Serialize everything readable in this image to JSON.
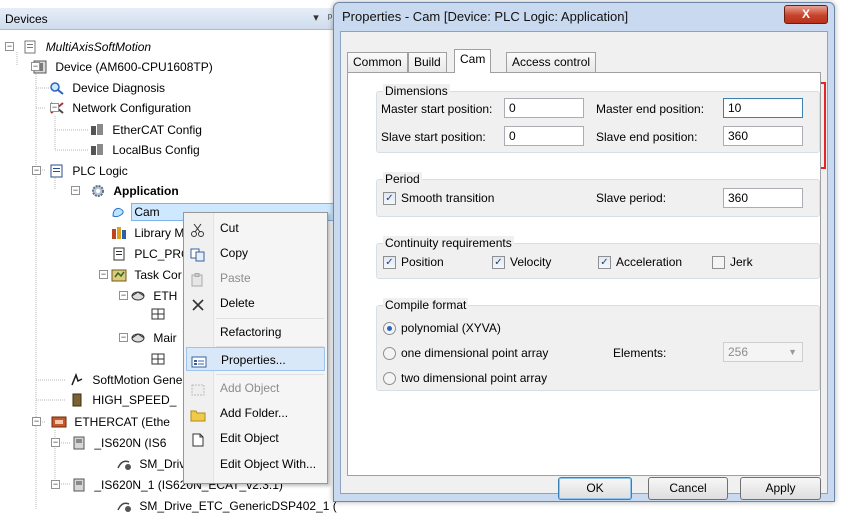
{
  "devices_panel": {
    "title": "Devices",
    "pin_glyph": "▾",
    "dock_glyph": "ᵖ"
  },
  "tree": {
    "project": "MultiAxisSoftMotion",
    "device": "Device (AM600-CPU1608TP)",
    "device_diagnosis": "Device Diagnosis",
    "network_configuration": "Network Configuration",
    "ethercat_config": "EtherCAT Config",
    "localbus_config": "LocalBus Config",
    "plc_logic": "PLC Logic",
    "application": "Application",
    "cam": "Cam",
    "library_manager": "Library M",
    "plc_prg": "PLC_PRC",
    "task_configuration": "Task Cor",
    "ethercat_task": "ETH",
    "main_task": "Mair",
    "softmotion_general": "SoftMotion Gene",
    "high_speed": "HIGH_SPEED_",
    "ethercat_master": "ETHERCAT (Ethe",
    "is620n": "_IS620N (IS6",
    "sm_drive_short": "SM_Driv",
    "is620n_1": "_IS620N_1 (IS620N_ECAT_v2.3.1)",
    "sm_drive_1": "SM_Drive_ETC_GenericDSP402_1 ("
  },
  "context_menu": {
    "items": [
      {
        "label": "Cut",
        "icon": "scissors-icon"
      },
      {
        "label": "Copy",
        "icon": "copy-icon"
      },
      {
        "label": "Paste",
        "icon": "paste-icon"
      },
      {
        "label": "Delete",
        "icon": "delete-icon"
      },
      {
        "label": "Refactoring",
        "icon": ""
      },
      {
        "label": "Properties...",
        "icon": "properties-icon"
      },
      {
        "label": "Add Object",
        "icon": "add-object-icon"
      },
      {
        "label": "Add Folder...",
        "icon": "folder-icon"
      },
      {
        "label": "Edit Object",
        "icon": "edit-object-icon"
      },
      {
        "label": "Edit Object With...",
        "icon": ""
      }
    ]
  },
  "dialog": {
    "title": "Properties - Cam [Device: PLC Logic: Application]",
    "close_label": "X",
    "tabs": [
      "Common",
      "Build",
      "Cam",
      "Access control"
    ],
    "active_tab": "Cam",
    "dimensions": {
      "title": "Dimensions",
      "master_start_label": "Master start position:",
      "master_start_value": "0",
      "master_end_label": "Master end position:",
      "master_end_value": "10",
      "slave_start_label": "Slave start position:",
      "slave_start_value": "0",
      "slave_end_label": "Slave end position:",
      "slave_end_value": "360"
    },
    "period": {
      "title": "Period",
      "smooth_transition_label": "Smooth transition",
      "smooth_transition_checked": true,
      "slave_period_label": "Slave period:",
      "slave_period_value": "360"
    },
    "continuity": {
      "title": "Continuity requirements",
      "position_label": "Position",
      "position_checked": true,
      "velocity_label": "Velocity",
      "velocity_checked": true,
      "acceleration_label": "Acceleration",
      "acceleration_checked": true,
      "jerk_label": "Jerk",
      "jerk_checked": false
    },
    "compile_format": {
      "title": "Compile format",
      "options": [
        "polynomial (XYVA)",
        "one dimensional point array",
        "two dimensional point array"
      ],
      "selected": "polynomial (XYVA)",
      "elements_label": "Elements:",
      "elements_value": "256"
    },
    "buttons": {
      "ok": "OK",
      "cancel": "Cancel",
      "apply": "Apply"
    }
  },
  "colors": {
    "highlight_box": "#e0252b",
    "selection": "#cde8ff",
    "dialog_frame": "#c9daf0"
  }
}
